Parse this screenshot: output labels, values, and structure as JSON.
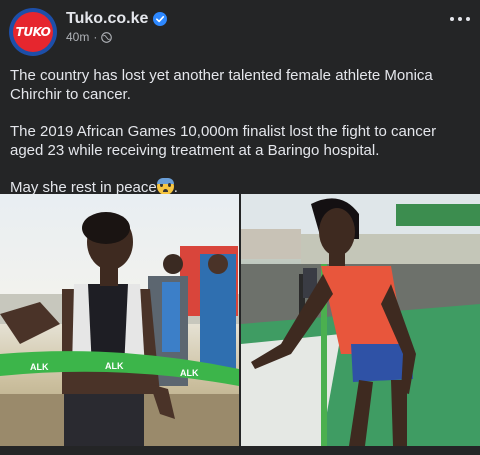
{
  "post": {
    "page_name": "Tuko.co.ke",
    "avatar_text": "TUKO",
    "timestamp": "40m",
    "separator": "·",
    "paragraphs": [
      "The country has lost yet another talented female athlete Monica Chirchir to cancer.",
      "The 2019 African Games 10,000m finalist lost the fight to cancer aged 23 while receiving treatment at a Baringo hospital.",
      "May she rest in peace"
    ],
    "trailing": "."
  },
  "photos": {
    "left": {
      "tape_text": [
        "ALK",
        "ALK",
        "ALK"
      ]
    }
  },
  "colors": {
    "background": "#242526",
    "text": "#e4e6eb",
    "secondary_text": "#b0b3b8",
    "verified": "#2d88ff",
    "brand_red": "#e6262e",
    "brand_blue": "#1d4fa8"
  },
  "icons": {
    "verified": "verified-badge-icon",
    "globe": "globe-icon",
    "more": "more-options-icon",
    "emoji": "anxious-face-icon"
  }
}
